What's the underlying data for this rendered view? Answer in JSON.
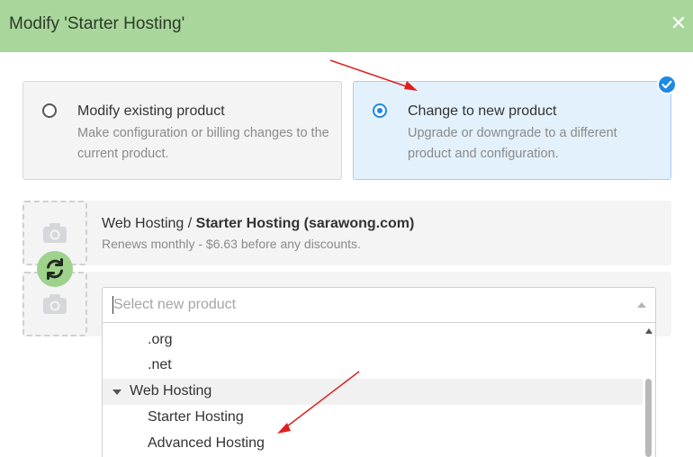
{
  "dialog": {
    "title": "Modify 'Starter Hosting'",
    "close_icon": "close-icon"
  },
  "options": [
    {
      "title": "Modify existing product",
      "description": "Make configuration or billing changes to the current product.",
      "selected": false
    },
    {
      "title": "Change to new product",
      "description": "Upgrade or downgrade to a different product and configuration.",
      "selected": true
    }
  ],
  "current_product": {
    "category": "Web Hosting /",
    "name": "Starter Hosting (sarawong.com)",
    "renewal": "Renews monthly - $6.63 before any discounts."
  },
  "select": {
    "placeholder": "Select new product"
  },
  "dropdown_items": [
    {
      "label": ".org",
      "type": "option"
    },
    {
      "label": ".net",
      "type": "option"
    },
    {
      "label": "Web Hosting",
      "type": "group"
    },
    {
      "label": "Starter Hosting",
      "type": "option"
    },
    {
      "label": "Advanced Hosting",
      "type": "option"
    }
  ],
  "colors": {
    "header_bg": "#a9d69a",
    "accent_blue": "#1e88e5",
    "selected_card_bg": "#e3f1fc",
    "annotation_arrow": "#e02020"
  }
}
